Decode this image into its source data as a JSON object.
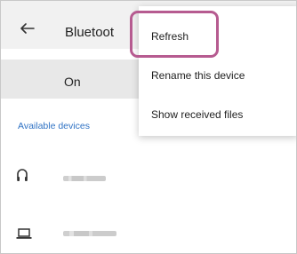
{
  "header": {
    "title": "Bluetoot"
  },
  "toggle": {
    "label": "On"
  },
  "section": {
    "title": "Available devices"
  },
  "devices": [
    {
      "icon": "headphones-icon",
      "name": "■■■■■"
    },
    {
      "icon": "laptop-icon",
      "name": "■■■■■■■"
    }
  ],
  "menu": {
    "items": [
      "Refresh",
      "Rename this device",
      "Show received files"
    ]
  },
  "colors": {
    "accent": "#2f72c4",
    "highlight": "#b65b90",
    "header_bg": "#f1f1f1"
  }
}
